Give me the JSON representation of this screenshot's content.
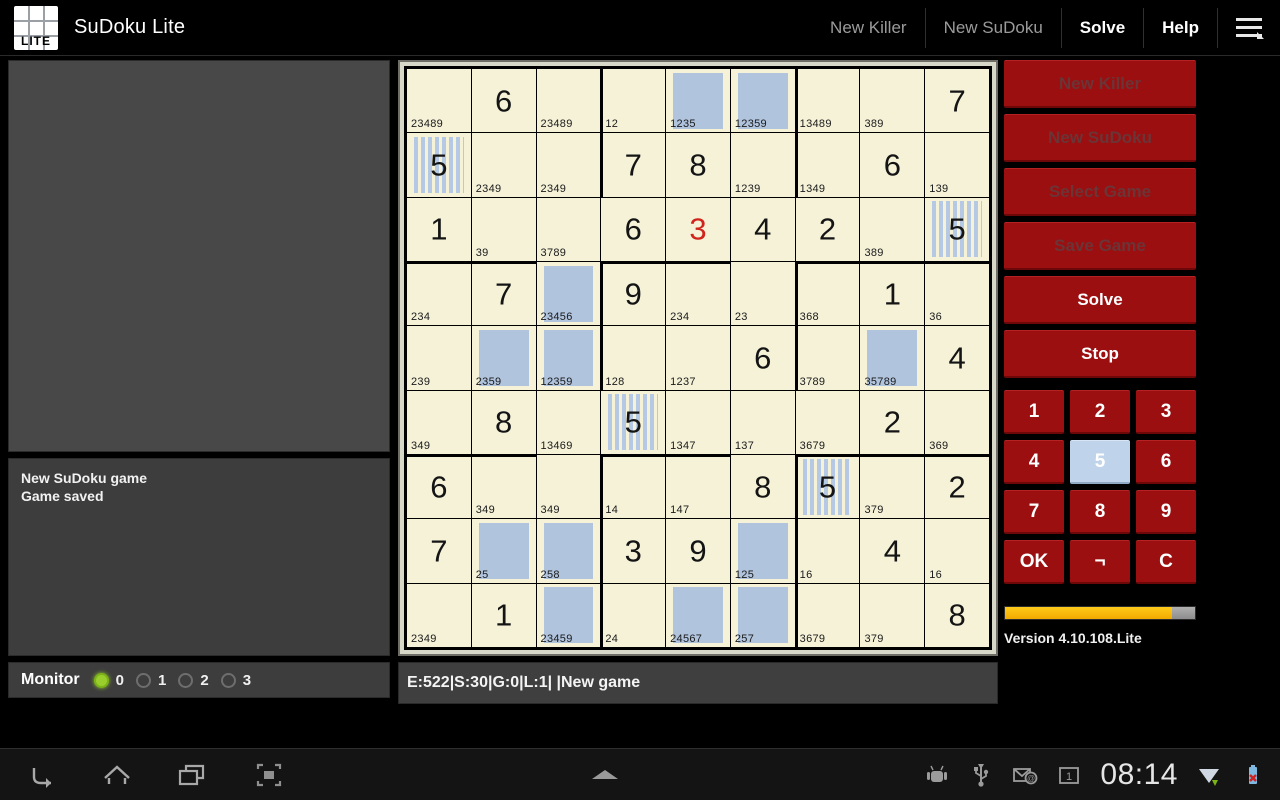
{
  "app": {
    "title": "SuDoku Lite",
    "logo_text": "LITE"
  },
  "actionbar": {
    "items": [
      {
        "label": "New Killer",
        "enabled": false
      },
      {
        "label": "New SuDoku",
        "enabled": false
      },
      {
        "label": "Solve",
        "enabled": true
      },
      {
        "label": "Help",
        "enabled": true
      }
    ],
    "menu_icon": "hamburger-menu-icon"
  },
  "log": {
    "lines": [
      "New SuDoku game",
      "Game saved"
    ]
  },
  "monitor": {
    "label": "Monitor",
    "options": [
      "0",
      "1",
      "2",
      "3"
    ],
    "selected": 0,
    "on_color": "#9ace2c"
  },
  "status": {
    "text": "E:522|S:30|G:0|L:1|  |New game"
  },
  "sidebar": {
    "buttons": [
      {
        "label": "New Killer",
        "enabled": false
      },
      {
        "label": "New SuDoku",
        "enabled": false
      },
      {
        "label": "Select Game",
        "enabled": false
      },
      {
        "label": "Save Game",
        "enabled": false
      },
      {
        "label": "Solve",
        "enabled": true
      },
      {
        "label": "Stop",
        "enabled": true
      }
    ],
    "keypad": [
      "1",
      "2",
      "3",
      "4",
      "5",
      "6",
      "7",
      "8",
      "9",
      "OK",
      "¬",
      "C"
    ],
    "keypad_selected": "5",
    "progress_percent": 88,
    "progress_color": "#f2a900",
    "version": "Version 4.10.108.Lite"
  },
  "board": {
    "accent_highlight": "#b0c4de",
    "cell_bg": "#f5f2d8",
    "error_color": "#d0241c",
    "cells": [
      [
        {
          "cand": "23489"
        },
        {
          "val": "6"
        },
        {
          "cand": "23489"
        },
        {
          "cand": "12"
        },
        {
          "cand": "1235",
          "hl": "solid"
        },
        {
          "cand": "12359",
          "hl": "solid"
        },
        {
          "cand": "13489"
        },
        {
          "cand": "389"
        },
        {
          "val": "7"
        }
      ],
      [
        {
          "val": "5",
          "hl": "stripes"
        },
        {
          "cand": "2349"
        },
        {
          "cand": "2349"
        },
        {
          "val": "7"
        },
        {
          "val": "8"
        },
        {
          "cand": "1239"
        },
        {
          "cand": "1349"
        },
        {
          "val": "6"
        },
        {
          "cand": "139"
        }
      ],
      [
        {
          "val": "1"
        },
        {
          "cand": "39"
        },
        {
          "cand": "3789"
        },
        {
          "val": "6"
        },
        {
          "val": "3",
          "err": true
        },
        {
          "val": "4"
        },
        {
          "val": "2"
        },
        {
          "cand": "389"
        },
        {
          "val": "5",
          "hl": "stripes"
        }
      ],
      [
        {
          "cand": "234"
        },
        {
          "val": "7"
        },
        {
          "cand": "23456",
          "hl": "solid"
        },
        {
          "val": "9"
        },
        {
          "cand": "234"
        },
        {
          "cand": "23"
        },
        {
          "cand": "368"
        },
        {
          "val": "1"
        },
        {
          "cand": "36"
        }
      ],
      [
        {
          "cand": "239"
        },
        {
          "cand": "2359",
          "hl": "solid"
        },
        {
          "cand": "12359",
          "hl": "solid"
        },
        {
          "cand": "128"
        },
        {
          "cand": "1237"
        },
        {
          "val": "6"
        },
        {
          "cand": "3789"
        },
        {
          "cand": "35789",
          "hl": "solid"
        },
        {
          "val": "4"
        }
      ],
      [
        {
          "cand": "349"
        },
        {
          "val": "8"
        },
        {
          "cand": "13469"
        },
        {
          "val": "5",
          "hl": "stripes"
        },
        {
          "cand": "1347"
        },
        {
          "cand": "137"
        },
        {
          "cand": "3679"
        },
        {
          "val": "2"
        },
        {
          "cand": "369"
        }
      ],
      [
        {
          "val": "6"
        },
        {
          "cand": "349"
        },
        {
          "cand": "349"
        },
        {
          "cand": "14"
        },
        {
          "cand": "147"
        },
        {
          "val": "8"
        },
        {
          "val": "5",
          "hl": "stripes"
        },
        {
          "cand": "379"
        },
        {
          "val": "2"
        }
      ],
      [
        {
          "val": "7"
        },
        {
          "cand": "25",
          "hl": "solid"
        },
        {
          "cand": "258",
          "hl": "solid"
        },
        {
          "val": "3"
        },
        {
          "val": "9"
        },
        {
          "cand": "125",
          "hl": "solid"
        },
        {
          "cand": "16"
        },
        {
          "val": "4"
        },
        {
          "cand": "16"
        }
      ],
      [
        {
          "cand": "2349"
        },
        {
          "val": "1"
        },
        {
          "cand": "23459",
          "hl": "solid"
        },
        {
          "cand": "24"
        },
        {
          "cand": "24567",
          "hl": "solid"
        },
        {
          "cand": "257",
          "hl": "solid"
        },
        {
          "cand": "3679"
        },
        {
          "cand": "379"
        },
        {
          "val": "8"
        }
      ]
    ]
  },
  "systembar": {
    "nav": [
      "back-icon",
      "home-icon",
      "recents-icon",
      "screenshot-icon"
    ],
    "center": "chevron-up-icon",
    "tray": [
      "android-icon",
      "usb-icon",
      "email-icon",
      "calendar-icon"
    ],
    "clock": "08:14",
    "signal": "wifi-icon",
    "battery": "battery-error-icon"
  }
}
